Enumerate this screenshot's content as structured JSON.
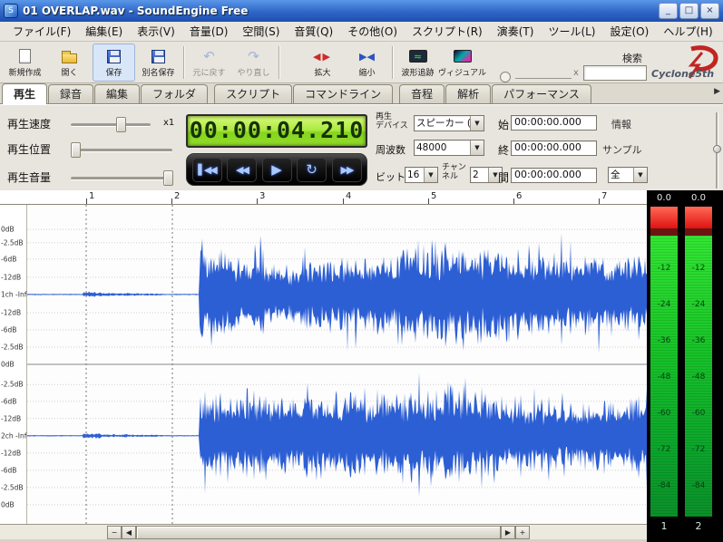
{
  "window": {
    "title": "01 OVERLAP.wav - SoundEngine Free",
    "icon_glyph": "S",
    "minimize": "_",
    "maximize": "□",
    "close": "×"
  },
  "menu": {
    "items": [
      "ファイル(F)",
      "編集(E)",
      "表示(V)",
      "音量(D)",
      "空間(S)",
      "音質(Q)",
      "その他(O)",
      "スクリプト(R)",
      "演奏(T)",
      "ツール(L)",
      "設定(O)",
      "ヘルプ(H)"
    ]
  },
  "toolbar": {
    "buttons": [
      {
        "label": "新規作成"
      },
      {
        "label": "開く"
      },
      {
        "label": "保存"
      },
      {
        "label": "別名保存"
      },
      {
        "label": "元に戻す"
      },
      {
        "label": "やり直し"
      },
      {
        "label": "拡大"
      },
      {
        "label": "縮小"
      },
      {
        "label": "波形追跡"
      },
      {
        "label": "ヴィジュアル"
      }
    ],
    "undo_glyph": "↶",
    "redo_glyph": "↷",
    "zoom_in_glyph": "◀▶",
    "zoom_out_glyph": "▶◀",
    "wave_trace_glyph": "≈",
    "search_label": "検索",
    "search_clear": "x",
    "logo_text": "Cyclone5th"
  },
  "tabs": {
    "items": [
      "再生",
      "録音",
      "編集",
      "フォルダ",
      "スクリプト",
      "コマンドライン",
      "音程",
      "解析",
      "パフォーマンス"
    ],
    "overflow_arrow": "▶"
  },
  "playback": {
    "speed_label": "再生速度",
    "speed_value": "x1",
    "position_label": "再生位置",
    "volume_label": "再生音量",
    "time_display": "00:00:04.210",
    "transport": [
      "▌◀◀",
      "◀◀",
      "▶",
      "↻",
      "▶▶"
    ],
    "device_label": "再生\nデバイス",
    "device_value": "スピーカー (",
    "freq_label": "周波数",
    "freq_value": "48000",
    "bit_label": "ビット",
    "bit_value": "16",
    "channel_label": "チャン\nネル",
    "channel_value": "2",
    "start_label": "始",
    "start_value": "00:00:00.000",
    "end_label": "終",
    "end_value": "00:00:00.000",
    "range_label": "間",
    "range_value": "00:00:00.000",
    "info_label": "情報",
    "sample_label": "サンプル",
    "all_label": "全",
    "dropdown_arrow": "▼"
  },
  "waveform": {
    "ruler_marks": [
      "1",
      "2",
      "3",
      "4",
      "5",
      "6",
      "7"
    ],
    "db_rows": [
      "0dB",
      "-2.5dB",
      "-6dB",
      "-12dB",
      "1ch -InfdB",
      "-12dB",
      "-6dB",
      "-2.5dB",
      "0dB",
      "-2.5dB",
      "-6dB",
      "-12dB",
      "2ch -InfdB",
      "-12dB",
      "-6dB",
      "-2.5dB",
      "0dB"
    ]
  },
  "meters": {
    "peaks": [
      "0.0",
      "0.0"
    ],
    "scale": [
      "-12",
      "-24",
      "-36",
      "-48",
      "-60",
      "-72",
      "-84"
    ],
    "channels": [
      "1",
      "2"
    ]
  },
  "scrollbar": {
    "zoom_out": "−",
    "scroll_left": "◀",
    "scroll_right": "▶",
    "zoom_in": "+"
  }
}
